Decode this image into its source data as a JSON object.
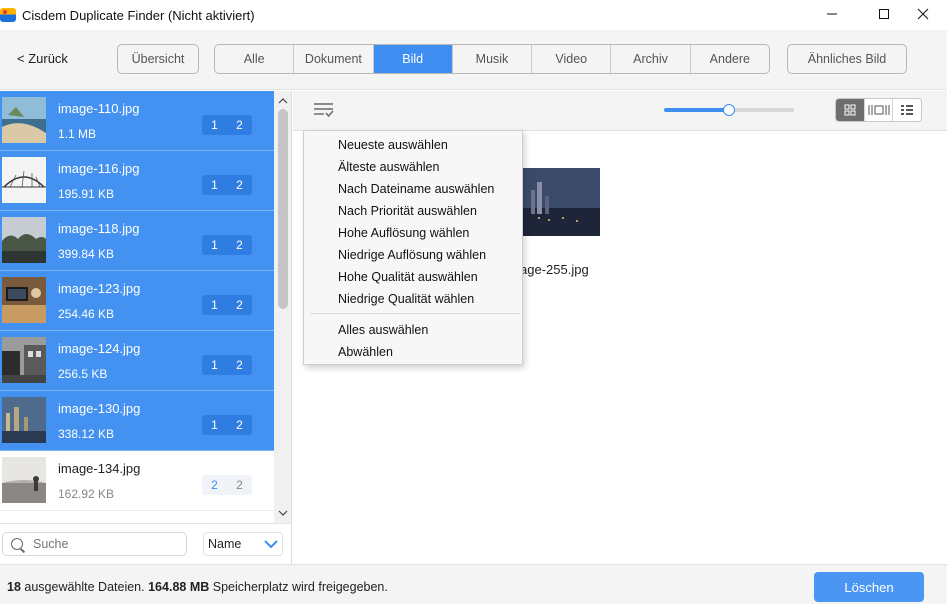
{
  "window": {
    "title": "Cisdem Duplicate Finder (Nicht aktiviert)",
    "minimize": "—",
    "maximize": "☐",
    "close": "✕"
  },
  "toolbar": {
    "back_label": "< Zurück",
    "overview_label": "Übersicht",
    "tabs": [
      {
        "label": "Alle",
        "active": false
      },
      {
        "label": "Dokument",
        "active": false
      },
      {
        "label": "Bild",
        "active": true
      },
      {
        "label": "Musik",
        "active": false
      },
      {
        "label": "Video",
        "active": false
      },
      {
        "label": "Archiv",
        "active": false
      },
      {
        "label": "Andere",
        "active": false
      }
    ],
    "similar_label": "Ähnliches Bild",
    "accent_color": "#3d8ef0"
  },
  "file_list": [
    {
      "name": "image-110.jpg",
      "size": "1.1 MB",
      "count_a": "1",
      "count_b": "2",
      "selected": true
    },
    {
      "name": "image-116.jpg",
      "size": "195.91 KB",
      "count_a": "1",
      "count_b": "2",
      "selected": true
    },
    {
      "name": "image-118.jpg",
      "size": "399.84 KB",
      "count_a": "1",
      "count_b": "2",
      "selected": true
    },
    {
      "name": "image-123.jpg",
      "size": "254.46 KB",
      "count_a": "1",
      "count_b": "2",
      "selected": true
    },
    {
      "name": "image-124.jpg",
      "size": "256.5 KB",
      "count_a": "1",
      "count_b": "2",
      "selected": true
    },
    {
      "name": "image-130.jpg",
      "size": "338.12 KB",
      "count_a": "1",
      "count_b": "2",
      "selected": true
    },
    {
      "name": "image-134.jpg",
      "size": "162.92 KB",
      "count_a": "2",
      "count_b": "2",
      "selected": false
    }
  ],
  "search": {
    "placeholder": "Suche",
    "value": ""
  },
  "sort": {
    "selected": "Name"
  },
  "menu": {
    "items": [
      "Neueste auswählen",
      "Älteste auswählen",
      "Nach Dateiname auswählen",
      "Nach Priorität auswählen",
      "Hohe Auflösung wählen",
      "Niedrige Auflösung wählen",
      "Hohe Qualität auswählen",
      "Niedrige Qualität wählen",
      "Alles auswählen",
      "Abwählen"
    ]
  },
  "preview": {
    "visible_name": "age-255.jpg"
  },
  "zoom_slider": {
    "fraction": 0.5
  },
  "status": {
    "selected_count": "18",
    "selected_text": "ausgewählte Dateien.",
    "freed_size": "164.88 MB",
    "freed_text": "Speicherplatz wird freigegeben.",
    "delete_label": "Löschen"
  }
}
